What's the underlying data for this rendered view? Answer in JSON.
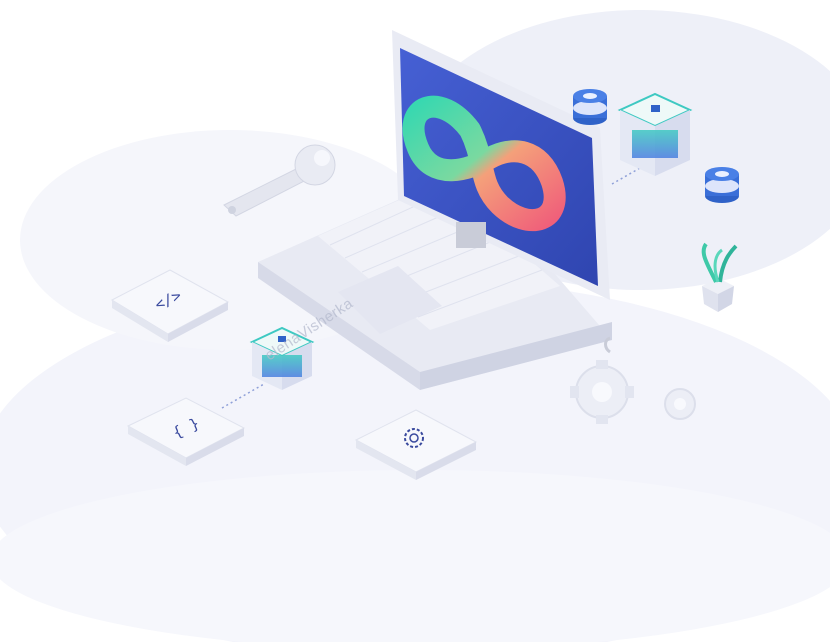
{
  "illustration": {
    "subject": "isometric DevOps laptop with infinity loop",
    "watermark_text": "elenaVisherka",
    "colors": {
      "screen": "#3f56c9",
      "infinity_gradient_start": "#38d8b0",
      "infinity_gradient_end": "#f0607a",
      "cube_accent": "#3ec9c2",
      "cube_blue": "#4a7fe0",
      "database_blue": "#2f62c8",
      "cloud": "#eceef8"
    },
    "icons": [
      "wrench-icon",
      "code-tag-icon",
      "curly-braces-icon",
      "gear-icon",
      "database-icon",
      "cube-icon",
      "plant-icon"
    ]
  }
}
